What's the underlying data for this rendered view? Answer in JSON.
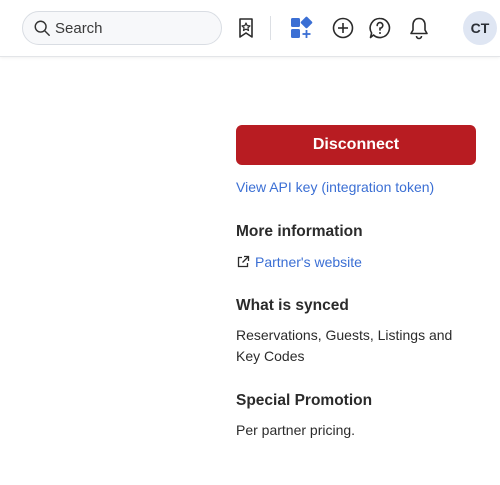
{
  "header": {
    "search_placeholder": "Search",
    "avatar_initials": "CT",
    "icons": [
      "search-icon",
      "bookmark-star-icon",
      "apps-add-icon",
      "plus-circle-icon",
      "help-bubble-icon",
      "bell-icon"
    ]
  },
  "actions": {
    "disconnect_label": "Disconnect",
    "api_key_link": "View API key (integration token)"
  },
  "more_info": {
    "title": "More information",
    "partner_link": "Partner's website"
  },
  "synced": {
    "title": "What is synced",
    "text": "Reservations, Guests, Listings and Key Codes"
  },
  "promotion": {
    "title": "Special Promotion",
    "text": "Per partner pricing."
  },
  "colors": {
    "disconnect_bg": "#b81c22",
    "link": "#3b6fd4",
    "apps_icon": "#3b6fd4"
  }
}
